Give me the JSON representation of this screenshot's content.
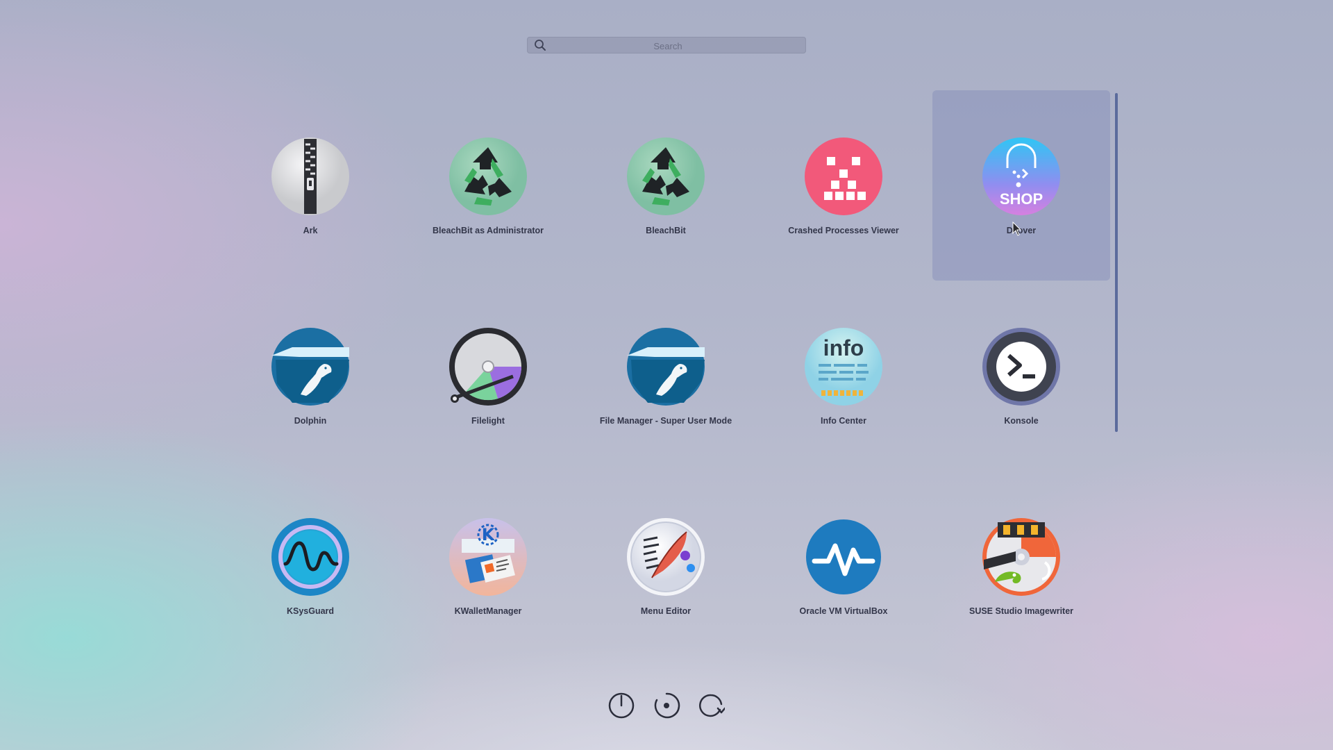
{
  "search": {
    "placeholder": "Search",
    "icon": "search-icon"
  },
  "apps": [
    {
      "name": "Ark",
      "icon": "ark-zipper-icon"
    },
    {
      "name": "BleachBit as Administrator",
      "icon": "recycle-icon"
    },
    {
      "name": "BleachBit",
      "icon": "recycle-icon"
    },
    {
      "name": "Crashed Processes Viewer",
      "icon": "crash-blocks-icon"
    },
    {
      "name": "Discover",
      "icon": "shop-bag-icon",
      "hovered": true,
      "visible_label": "Di  over"
    },
    {
      "name": "Dolphin",
      "icon": "dolphin-folder-icon"
    },
    {
      "name": "Filelight",
      "icon": "disk-pie-icon"
    },
    {
      "name": "File Manager - Super User Mode",
      "icon": "dolphin-folder-icon"
    },
    {
      "name": "Info Center",
      "icon": "info-icon"
    },
    {
      "name": "Konsole",
      "icon": "terminal-icon"
    },
    {
      "name": "KSysGuard",
      "icon": "wave-monitor-icon"
    },
    {
      "name": "KWalletManager",
      "icon": "wallet-icon"
    },
    {
      "name": "Menu Editor",
      "icon": "quill-icon"
    },
    {
      "name": "Oracle VM VirtualBox",
      "icon": "pulse-icon"
    },
    {
      "name": "SUSE Studio Imagewriter",
      "icon": "usb-chameleon-icon"
    }
  ],
  "power_buttons": [
    {
      "name": "shutdown",
      "icon": "power-icon"
    },
    {
      "name": "logout",
      "icon": "session-icon"
    },
    {
      "name": "restart",
      "icon": "restart-icon"
    }
  ],
  "colors": {
    "hover_tile": "#8c96bd",
    "label": "#33364a",
    "scrollbar": "#5b6b9c"
  }
}
